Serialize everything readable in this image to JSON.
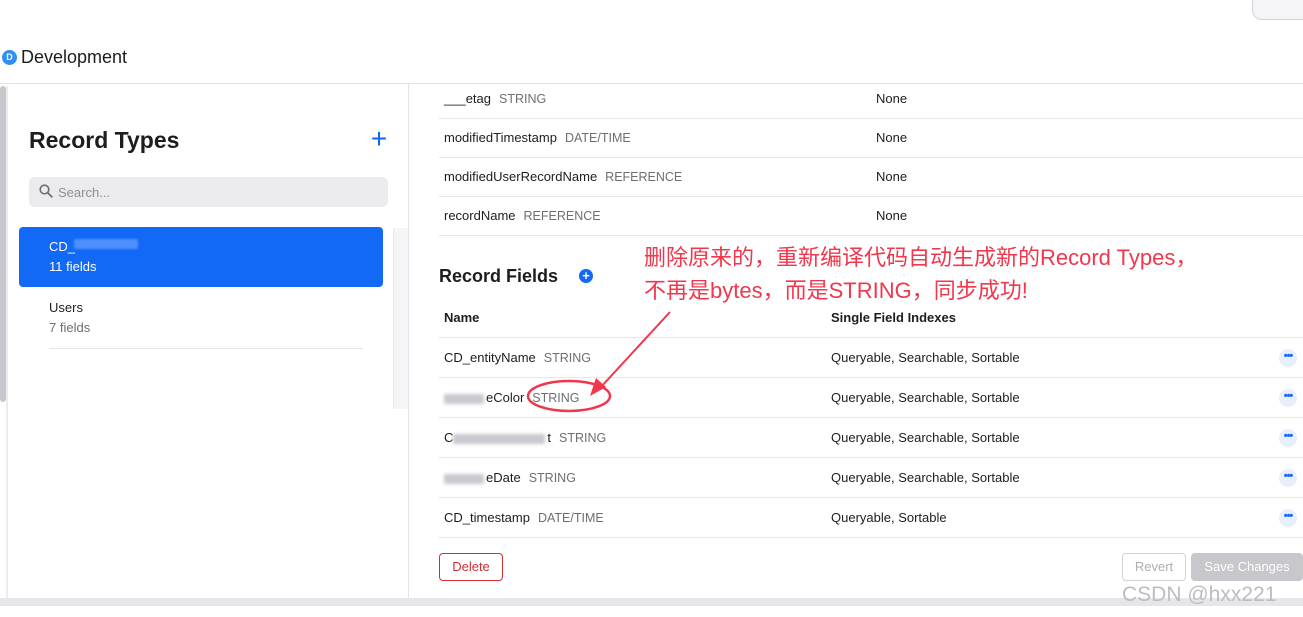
{
  "header": {
    "env_initial": "D",
    "env_label": "Development"
  },
  "sidebar": {
    "title": "Record Types",
    "add_icon": "plus-icon",
    "search_placeholder": "Search...",
    "items": [
      {
        "name": "CD_",
        "count": "11 fields",
        "selected": true
      },
      {
        "name": "Users",
        "count": "7 fields",
        "selected": false
      }
    ]
  },
  "system_fields": [
    {
      "name": "___etag",
      "type": "STRING",
      "index": "None"
    },
    {
      "name": "modifiedTimestamp",
      "type": "DATE/TIME",
      "index": "None"
    },
    {
      "name": "modifiedUserRecordName",
      "type": "REFERENCE",
      "index": "None"
    },
    {
      "name": "recordName",
      "type": "REFERENCE",
      "index": "None"
    }
  ],
  "record_fields": {
    "title": "Record Fields",
    "col_name": "Name",
    "col_index": "Single Field Indexes",
    "rows": [
      {
        "name": "CD_entityName",
        "type": "STRING",
        "index": "Queryable, Searchable, Sortable"
      },
      {
        "name": "eColor",
        "type": "STRING",
        "index": "Queryable, Searchable, Sortable"
      },
      {
        "name": "C",
        "name_suffix": "t",
        "type": "STRING",
        "index": "Queryable, Searchable, Sortable"
      },
      {
        "name": "eDate",
        "type": "STRING",
        "index": "Queryable, Searchable, Sortable"
      },
      {
        "name": "CD_timestamp",
        "type": "DATE/TIME",
        "index": "Queryable, Sortable"
      }
    ],
    "more_label": "•••"
  },
  "actions": {
    "delete": "Delete",
    "revert": "Revert",
    "save": "Save Changes"
  },
  "annotation": {
    "line1": "删除原来的，重新编译代码自动生成新的Record Types，",
    "line2": "不再是bytes，而是STRING，同步成功!",
    "color": "#f0374c"
  },
  "watermark": "CSDN @hxx221",
  "colors": {
    "accent": "#1269f5",
    "danger": "#d0302f"
  }
}
